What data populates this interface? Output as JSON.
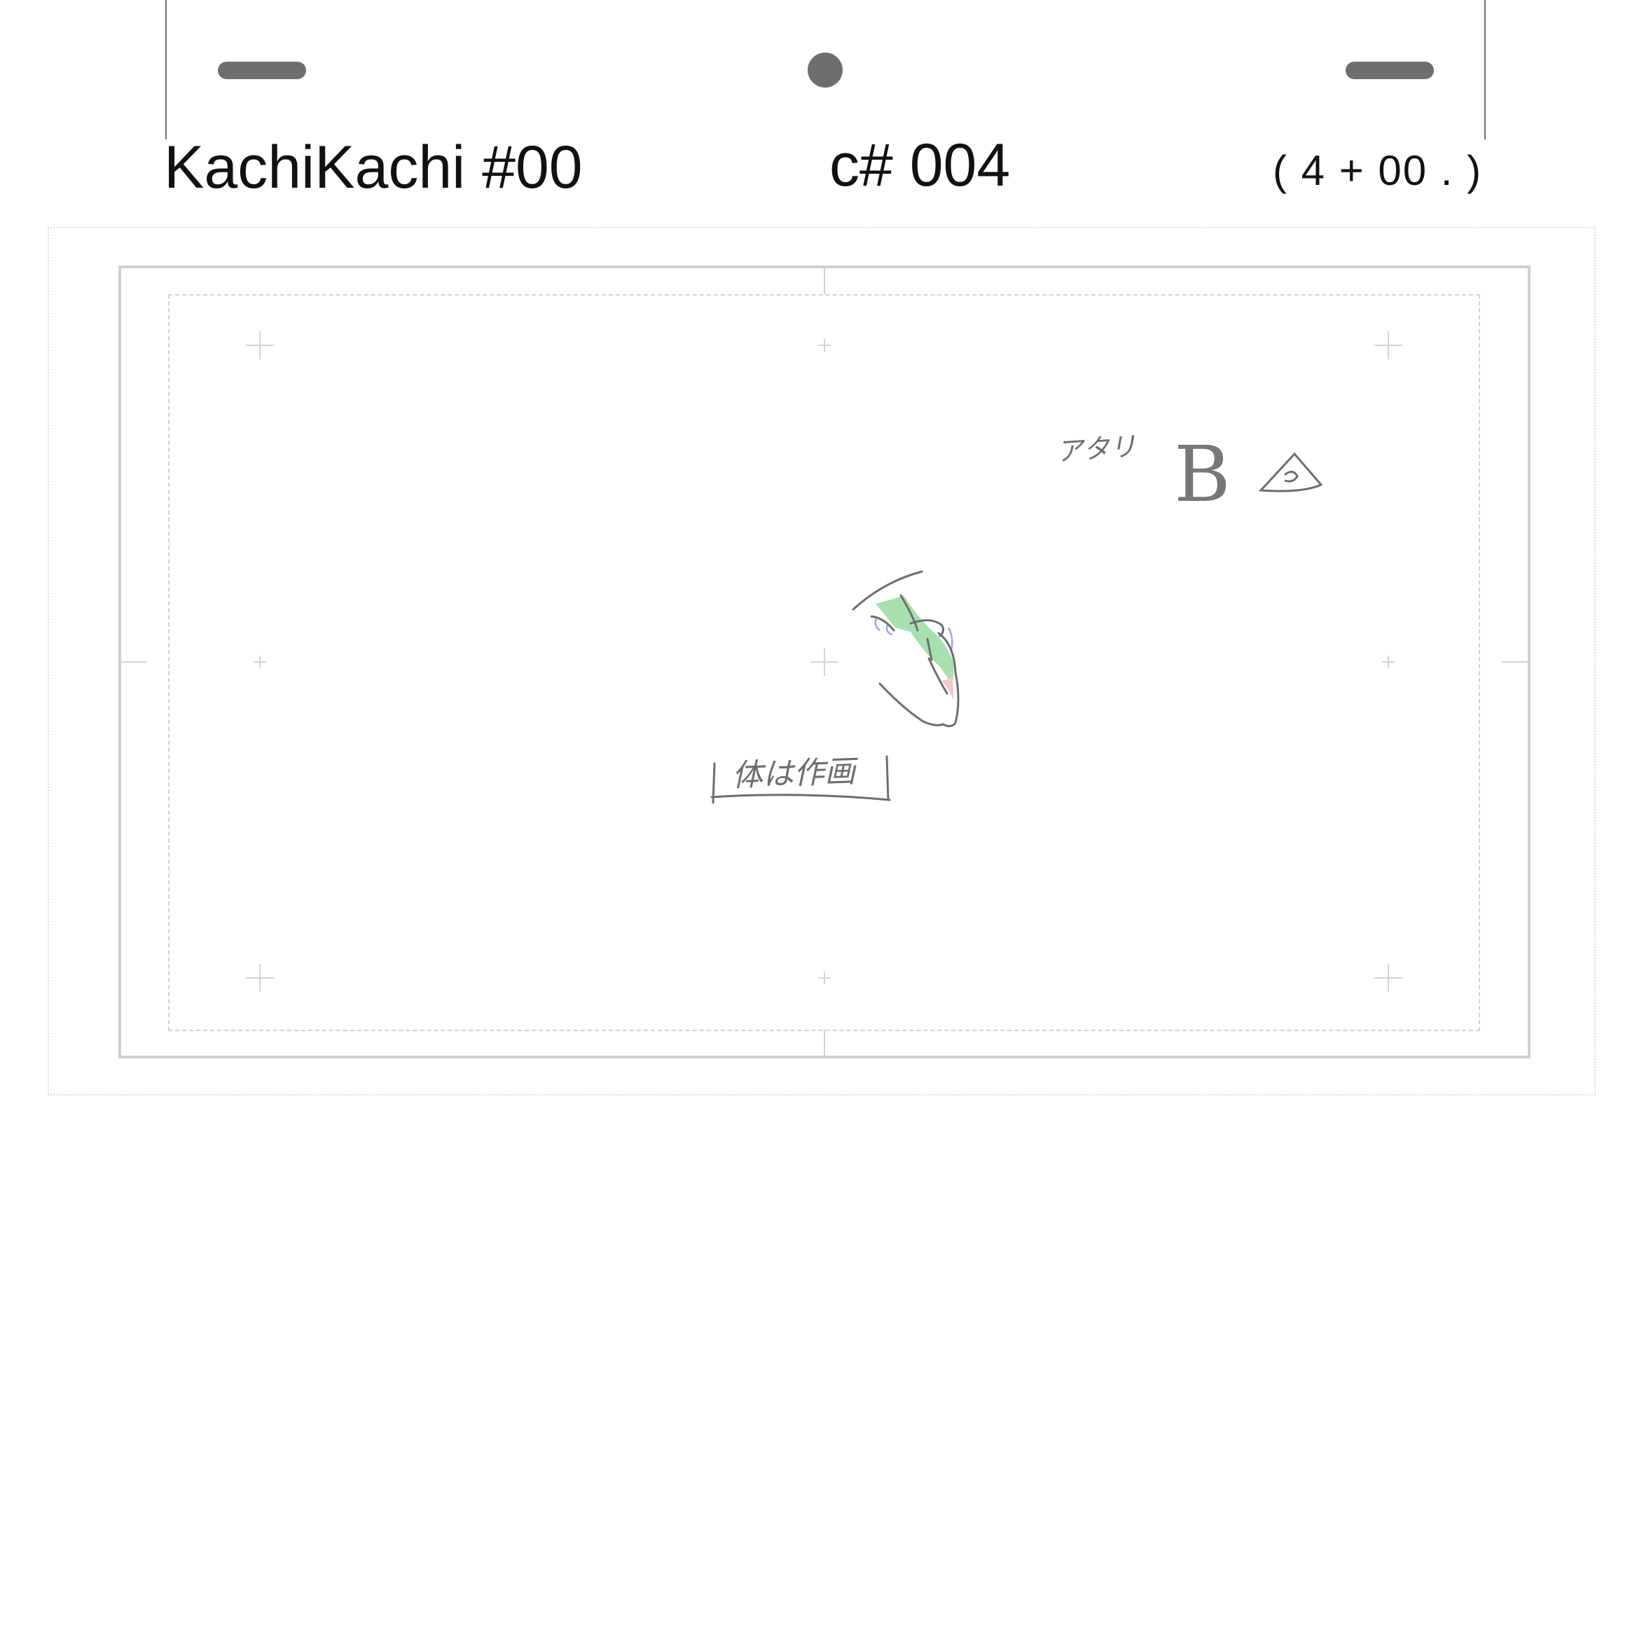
{
  "header": {
    "title": "KachiKachi #00",
    "cut": "c# 004",
    "time": "( 4 + 00 . )"
  },
  "sketch": {
    "atari_note": "アタリ",
    "layer_letter": "B",
    "body_note": "体は作画"
  },
  "icons": {
    "peg_slot": "peg-slot-icon",
    "peg_hole": "peg-hole-icon",
    "registration_mark": "crosshair-icon",
    "triangle_mark": "triangle-mark-icon"
  },
  "colors": {
    "peg": "#6e6e6e",
    "frame": "#d0d0d0",
    "pencil": "#6e6e6e",
    "shadow_green": "#a8e0b0",
    "highlight_blue": "#9aa8e0",
    "cheek_pink": "#f4c8c8"
  }
}
